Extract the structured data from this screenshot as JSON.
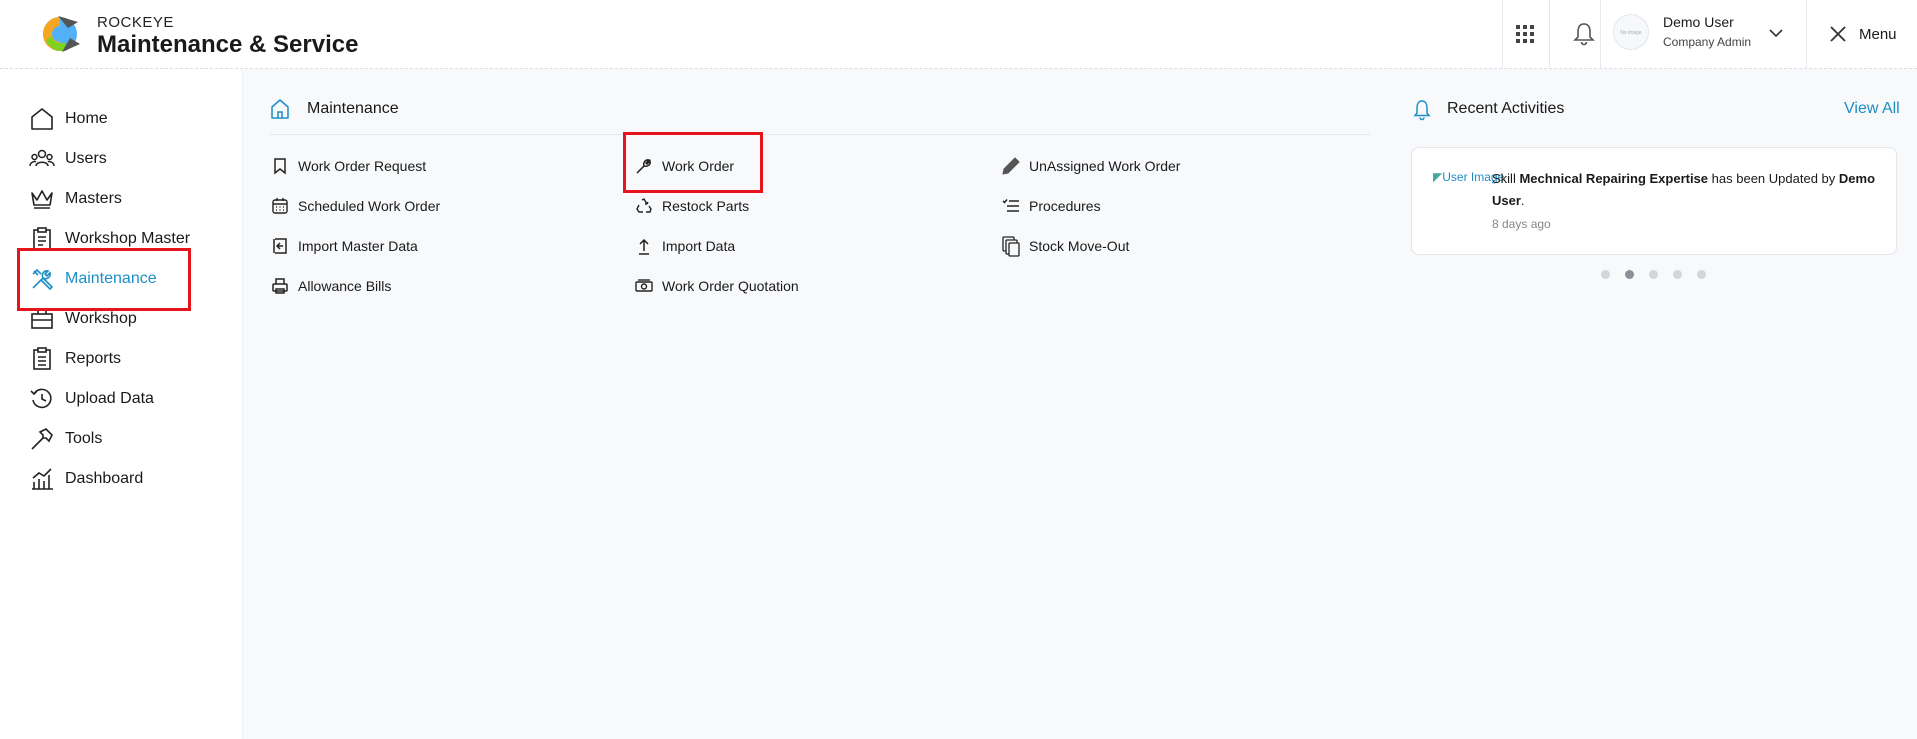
{
  "header": {
    "brand_top": "ROCKEYE",
    "brand_main": "Maintenance & Service",
    "user_name": "Demo User",
    "user_role": "Company Admin",
    "avatar_text": "No image",
    "menu_label": "Menu"
  },
  "sidebar": {
    "items": [
      {
        "label": "Home",
        "icon": "home-icon"
      },
      {
        "label": "Users",
        "icon": "users-icon"
      },
      {
        "label": "Masters",
        "icon": "crown-icon"
      },
      {
        "label": "Workshop Master",
        "icon": "clipboard-icon"
      },
      {
        "label": "Maintenance",
        "icon": "tools-icon",
        "active": true
      },
      {
        "label": "Workshop",
        "icon": "briefcase-icon"
      },
      {
        "label": "Reports",
        "icon": "report-icon"
      },
      {
        "label": "Upload Data",
        "icon": "history-icon"
      },
      {
        "label": "Tools",
        "icon": "hammer-icon"
      },
      {
        "label": "Dashboard",
        "icon": "chart-icon"
      }
    ]
  },
  "main": {
    "section_title": "Maintenance",
    "links": [
      {
        "label": "Work Order Request",
        "icon": "bookmark-icon"
      },
      {
        "label": "Work Order",
        "icon": "wrench-icon"
      },
      {
        "label": "UnAssigned Work Order",
        "icon": "pencil-icon"
      },
      {
        "label": "Scheduled Work Order",
        "icon": "calendar-icon"
      },
      {
        "label": "Restock Parts",
        "icon": "recycle-icon"
      },
      {
        "label": "Procedures",
        "icon": "checklist-icon"
      },
      {
        "label": "Import Master Data",
        "icon": "import-icon"
      },
      {
        "label": "Import Data",
        "icon": "upload-arrow-icon"
      },
      {
        "label": "Stock Move-Out",
        "icon": "copy-icon"
      },
      {
        "label": "Allowance Bills",
        "icon": "printer-icon"
      },
      {
        "label": "Work Order Quotation",
        "icon": "cash-icon"
      }
    ]
  },
  "recent": {
    "title": "Recent Activities",
    "view_all": "View All",
    "image_alt": "User Image",
    "text_prefix": "Skill",
    "text_subject": "Mechnical Repairing Expertise",
    "text_middle": "has been Updated by",
    "text_user": "Demo User",
    "text_suffix": ".",
    "time": "8 days ago",
    "dots": 5,
    "active_dot": 1
  },
  "colors": {
    "accent": "#1d8ec6",
    "highlight": "#e8141b"
  }
}
